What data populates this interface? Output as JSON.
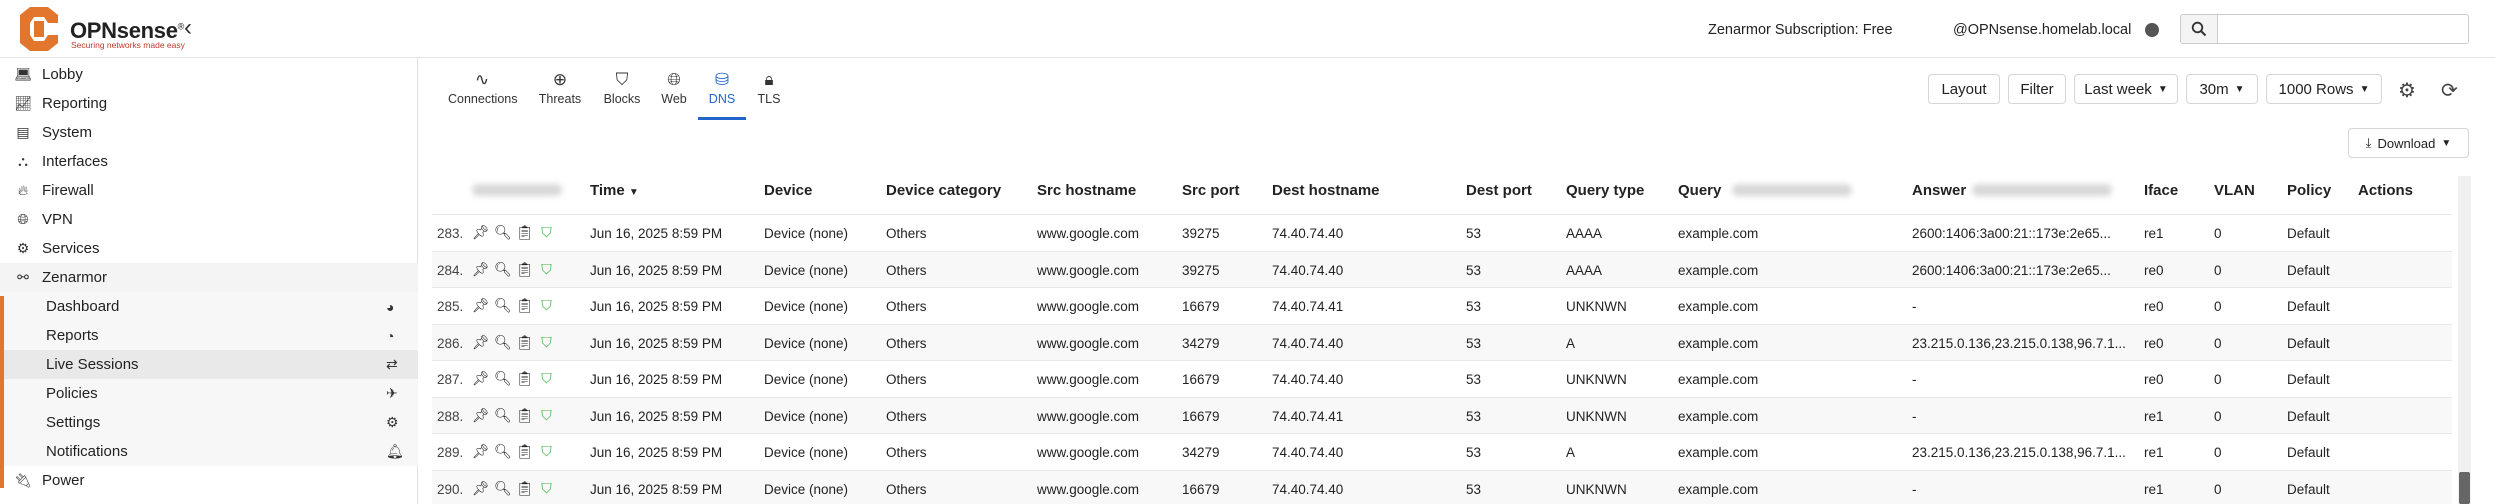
{
  "header": {
    "brand": "OPNsense",
    "brand_mark": "®",
    "tagline": "Securing networks made easy",
    "subscription": "Zenarmor Subscription: Free",
    "user_host": "@OPNsense.homelab.local",
    "search_placeholder": ""
  },
  "sidebar": {
    "items": [
      {
        "label": "Lobby",
        "icon": "laptop-icon"
      },
      {
        "label": "Reporting",
        "icon": "chart-icon"
      },
      {
        "label": "System",
        "icon": "server-icon"
      },
      {
        "label": "Interfaces",
        "icon": "sitemap-icon"
      },
      {
        "label": "Firewall",
        "icon": "fire-icon"
      },
      {
        "label": "VPN",
        "icon": "globe-icon"
      },
      {
        "label": "Services",
        "icon": "gear-icon"
      },
      {
        "label": "Zenarmor",
        "icon": "binoculars-icon"
      },
      {
        "label": "Power",
        "icon": "plug-icon"
      }
    ],
    "zenarmor_sub": [
      {
        "label": "Dashboard",
        "icon": "dashboard-icon"
      },
      {
        "label": "Reports",
        "icon": "pie-icon"
      },
      {
        "label": "Live Sessions",
        "icon": "exchange-icon"
      },
      {
        "label": "Policies",
        "icon": "plane-icon"
      },
      {
        "label": "Settings",
        "icon": "cog-icon"
      },
      {
        "label": "Notifications",
        "icon": "bell-icon"
      }
    ]
  },
  "tabs": [
    {
      "label": "Connections",
      "icon": "activity-icon"
    },
    {
      "label": "Threats",
      "icon": "crosshair-icon"
    },
    {
      "label": "Blocks",
      "icon": "shield-icon"
    },
    {
      "label": "Web",
      "icon": "globe-icon"
    },
    {
      "label": "DNS",
      "icon": "database-icon"
    },
    {
      "label": "TLS",
      "icon": "lock-icon"
    }
  ],
  "toolbar": {
    "layout": "Layout",
    "filter": "Filter",
    "range": "Last week",
    "refresh": "30m",
    "rows": "1000 Rows",
    "download": "Download"
  },
  "table": {
    "columns": [
      "Time",
      "Device",
      "Device category",
      "Src hostname",
      "Src port",
      "Dest hostname",
      "Dest port",
      "Query type",
      "Query",
      "Answer",
      "Iface",
      "VLAN",
      "Policy",
      "Actions"
    ],
    "rows": [
      {
        "n": "283.",
        "time": "Jun 16, 2025 8:59 PM",
        "device": "Device (none)",
        "cat": "Others",
        "src": "www.google.com",
        "sport": "39275",
        "dest": "74.40.74.40",
        "dport": "53",
        "qtype": "AAAA",
        "query": "example.com",
        "answer": "2600:1406:3a00:21::173e:2e65...",
        "iface": "re1",
        "vlan": "0",
        "policy": "Default"
      },
      {
        "n": "284.",
        "time": "Jun 16, 2025 8:59 PM",
        "device": "Device (none)",
        "cat": "Others",
        "src": "www.google.com",
        "sport": "39275",
        "dest": "74.40.74.40",
        "dport": "53",
        "qtype": "AAAA",
        "query": "example.com",
        "answer": "2600:1406:3a00:21::173e:2e65...",
        "iface": "re0",
        "vlan": "0",
        "policy": "Default"
      },
      {
        "n": "285.",
        "time": "Jun 16, 2025 8:59 PM",
        "device": "Device (none)",
        "cat": "Others",
        "src": "www.google.com",
        "sport": "16679",
        "dest": "74.40.74.41",
        "dport": "53",
        "qtype": "UNKNWN",
        "query": "example.com",
        "answer": "-",
        "iface": "re0",
        "vlan": "0",
        "policy": "Default"
      },
      {
        "n": "286.",
        "time": "Jun 16, 2025 8:59 PM",
        "device": "Device (none)",
        "cat": "Others",
        "src": "www.google.com",
        "sport": "34279",
        "dest": "74.40.74.40",
        "dport": "53",
        "qtype": "A",
        "query": "example.com",
        "answer": "23.215.0.136,23.215.0.138,96.7.1...",
        "iface": "re0",
        "vlan": "0",
        "policy": "Default"
      },
      {
        "n": "287.",
        "time": "Jun 16, 2025 8:59 PM",
        "device": "Device (none)",
        "cat": "Others",
        "src": "www.google.com",
        "sport": "16679",
        "dest": "74.40.74.40",
        "dport": "53",
        "qtype": "UNKNWN",
        "query": "example.com",
        "answer": "-",
        "iface": "re0",
        "vlan": "0",
        "policy": "Default"
      },
      {
        "n": "288.",
        "time": "Jun 16, 2025 8:59 PM",
        "device": "Device (none)",
        "cat": "Others",
        "src": "www.google.com",
        "sport": "16679",
        "dest": "74.40.74.41",
        "dport": "53",
        "qtype": "UNKNWN",
        "query": "example.com",
        "answer": "-",
        "iface": "re1",
        "vlan": "0",
        "policy": "Default"
      },
      {
        "n": "289.",
        "time": "Jun 16, 2025 8:59 PM",
        "device": "Device (none)",
        "cat": "Others",
        "src": "www.google.com",
        "sport": "34279",
        "dest": "74.40.74.40",
        "dport": "53",
        "qtype": "A",
        "query": "example.com",
        "answer": "23.215.0.136,23.215.0.138,96.7.1...",
        "iface": "re1",
        "vlan": "0",
        "policy": "Default"
      },
      {
        "n": "290.",
        "time": "Jun 16, 2025 8:59 PM",
        "device": "Device (none)",
        "cat": "Others",
        "src": "www.google.com",
        "sport": "16679",
        "dest": "74.40.74.40",
        "dport": "53",
        "qtype": "UNKNWN",
        "query": "example.com",
        "answer": "-",
        "iface": "re1",
        "vlan": "0",
        "policy": "Default"
      }
    ]
  },
  "colors": {
    "accent": "#e2762c",
    "tab_active": "#2266cc",
    "shield": "#3cb043"
  }
}
